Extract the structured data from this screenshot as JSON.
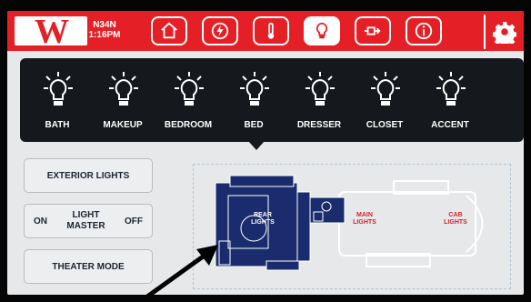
{
  "header": {
    "brand_letter": "W",
    "model": "N34N",
    "time": "1:16PM",
    "tabs": [
      {
        "icon": "home-icon"
      },
      {
        "icon": "power-icon"
      },
      {
        "icon": "thermometer-icon"
      },
      {
        "icon": "lightbulb-icon",
        "active": true
      },
      {
        "icon": "slideout-icon"
      },
      {
        "icon": "info-icon"
      }
    ],
    "settings_icon": "gear-icon",
    "accent_color": "#e41f26"
  },
  "lights": [
    {
      "label": "BATH"
    },
    {
      "label": "MAKEUP"
    },
    {
      "label": "BEDROOM"
    },
    {
      "label": "BED"
    },
    {
      "label": "DRESSER"
    },
    {
      "label": "CLOSET"
    },
    {
      "label": "ACCENT"
    }
  ],
  "sidebar": {
    "exterior_lights": "EXTERIOR LIGHTS",
    "light_master": {
      "on": "ON",
      "label": "LIGHT MASTER",
      "off": "OFF"
    },
    "theater_mode": "THEATER MODE"
  },
  "floorplan": {
    "rear_lights": "REAR LIGHTS",
    "main_lights": "MAIN LIGHTS",
    "cab_lights": "CAB LIGHTS",
    "active_color": "#1a2c6e",
    "inactive_label_color": "#d4242a"
  }
}
